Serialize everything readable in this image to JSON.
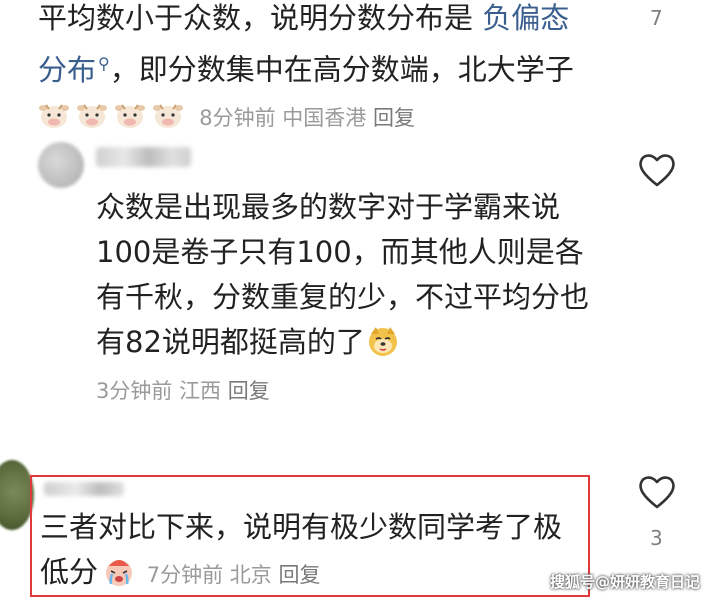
{
  "comments": [
    {
      "text_before_link": "平均数小于众数，说明分数分布是 ",
      "link": "负偏态分布",
      "text_after_link": "，即分数集中在高分数端，北大学子",
      "emoji": [
        "cow-emoji",
        "cow-emoji",
        "cow-emoji",
        "cow-emoji"
      ],
      "time": "8分钟前",
      "location": "中国香港",
      "reply": "回复",
      "likes": "7"
    },
    {
      "text": "众数是出现最多的数字对于学霸来说100是卷子只有100，而其他人则是各有千秋，分数重复的少，不过平均分也有82说明都挺高的了",
      "emoji": "doge-emoji",
      "time": "3分钟前",
      "location": "江西",
      "reply": "回复"
    },
    {
      "text": "三者对比下来，说明有极少数同学考了极低分",
      "emoji": "crying-emoji",
      "time": "7分钟前",
      "location": "北京",
      "reply": "回复",
      "likes": "3"
    }
  ],
  "watermark": "搜狐号@妍妍教育日记",
  "colors": {
    "link": "#3a5f8f",
    "highlight": "#e03a3a",
    "meta": "#9a9a9a"
  }
}
